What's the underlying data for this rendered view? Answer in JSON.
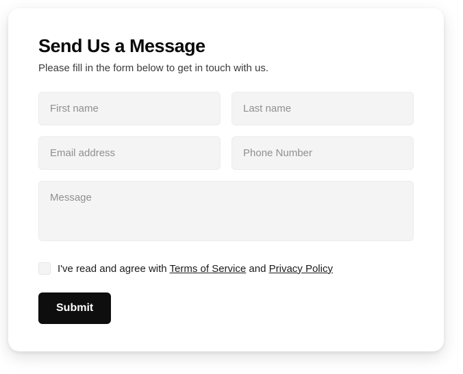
{
  "form": {
    "heading": "Send Us a Message",
    "subtext": "Please fill in the form below to get in touch with us.",
    "fields": {
      "first_name": {
        "placeholder": "First name",
        "value": ""
      },
      "last_name": {
        "placeholder": "Last name",
        "value": ""
      },
      "email": {
        "placeholder": "Email address",
        "value": ""
      },
      "phone": {
        "placeholder": "Phone Number",
        "value": ""
      },
      "message": {
        "placeholder": "Message",
        "value": ""
      }
    },
    "agree": {
      "checked": false,
      "prefix": "I've read and agree with ",
      "tos_label": "Terms of Service",
      "middle": " and ",
      "privacy_label": "Privacy Policy"
    },
    "submit_label": "Submit"
  }
}
